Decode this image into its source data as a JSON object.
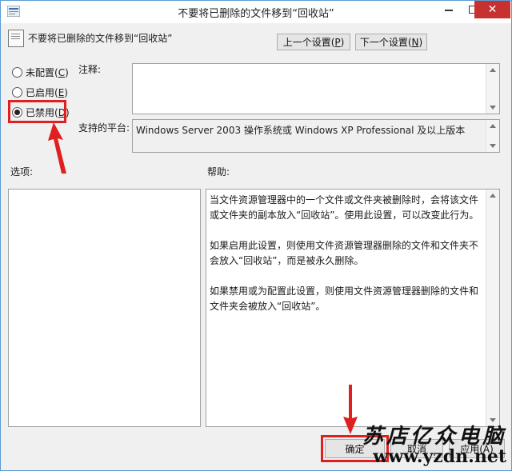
{
  "window": {
    "title": "不要将已删除的文件移到“回收站”",
    "close_glyph": "✕"
  },
  "header": {
    "policy_name": "不要将已删除的文件移到“回收站”",
    "prev_button": {
      "text": "上一个设置(",
      "key": "P",
      "end": ")"
    },
    "next_button": {
      "text": "下一个设置(",
      "key": "N",
      "end": ")"
    }
  },
  "state_options": [
    {
      "text": "未配置(",
      "key": "C",
      "end": ")",
      "selected": false
    },
    {
      "text": "已启用(",
      "key": "E",
      "end": ")",
      "selected": false
    },
    {
      "text": "已禁用(",
      "key": "D",
      "end": ")",
      "selected": true
    }
  ],
  "comment": {
    "label": "注释:",
    "value": ""
  },
  "platform": {
    "label": "支持的平台:",
    "value": "Windows Server 2003 操作系统或 Windows XP Professional 及以上版本"
  },
  "options_label": "选项:",
  "help": {
    "label": "帮助:",
    "paragraphs": [
      "当文件资源管理器中的一个文件或文件夹被删除时，会将该文件或文件夹的副本放入“回收站”。使用此设置，可以改变此行为。",
      "如果启用此设置，则使用文件资源管理器删除的文件和文件夹不会放入“回收站”，而是被永久删除。",
      "如果禁用或为配置此设置，则使用文件资源管理器删除的文件和文件夹会被放入“回收站”。"
    ]
  },
  "footer": {
    "ok_label": "确定",
    "cancel_label": "取消",
    "apply_label": "应用(A)"
  },
  "watermark": {
    "name": "苏店亿众电脑",
    "url": "www.yzdn.net"
  },
  "colors": {
    "highlight": "#e02020",
    "close_button": "#c7312f"
  }
}
